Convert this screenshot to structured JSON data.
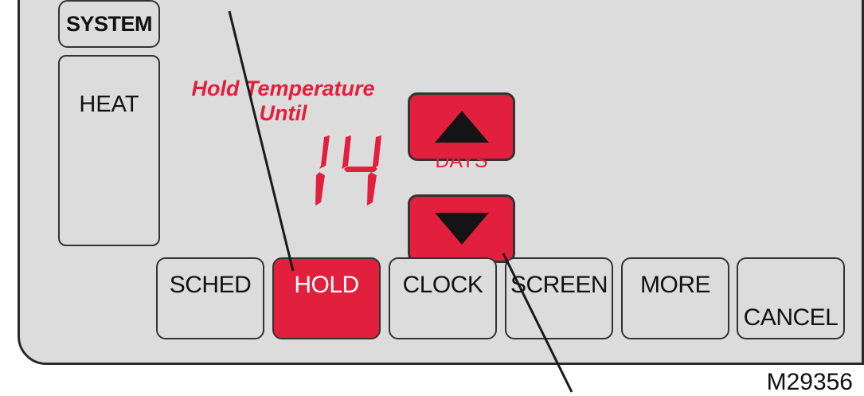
{
  "system": {
    "button_label": "SYSTEM",
    "mode": "HEAT"
  },
  "hold_display": {
    "line1": "Hold Temperature",
    "line2": "Until",
    "value": "14",
    "unit": "DAYS"
  },
  "arrows": {
    "up_icon": "up-triangle-icon",
    "down_icon": "down-triangle-icon"
  },
  "buttons": [
    {
      "label": "SCHED"
    },
    {
      "label": "HOLD"
    },
    {
      "label": "CLOCK"
    },
    {
      "label": "SCREEN"
    },
    {
      "label": "MORE"
    },
    {
      "label": "CANCEL"
    }
  ],
  "figure_id": "M29356",
  "colors": {
    "accent": "#e2203e",
    "panel": "#dcdcdc",
    "outline": "#333333"
  }
}
